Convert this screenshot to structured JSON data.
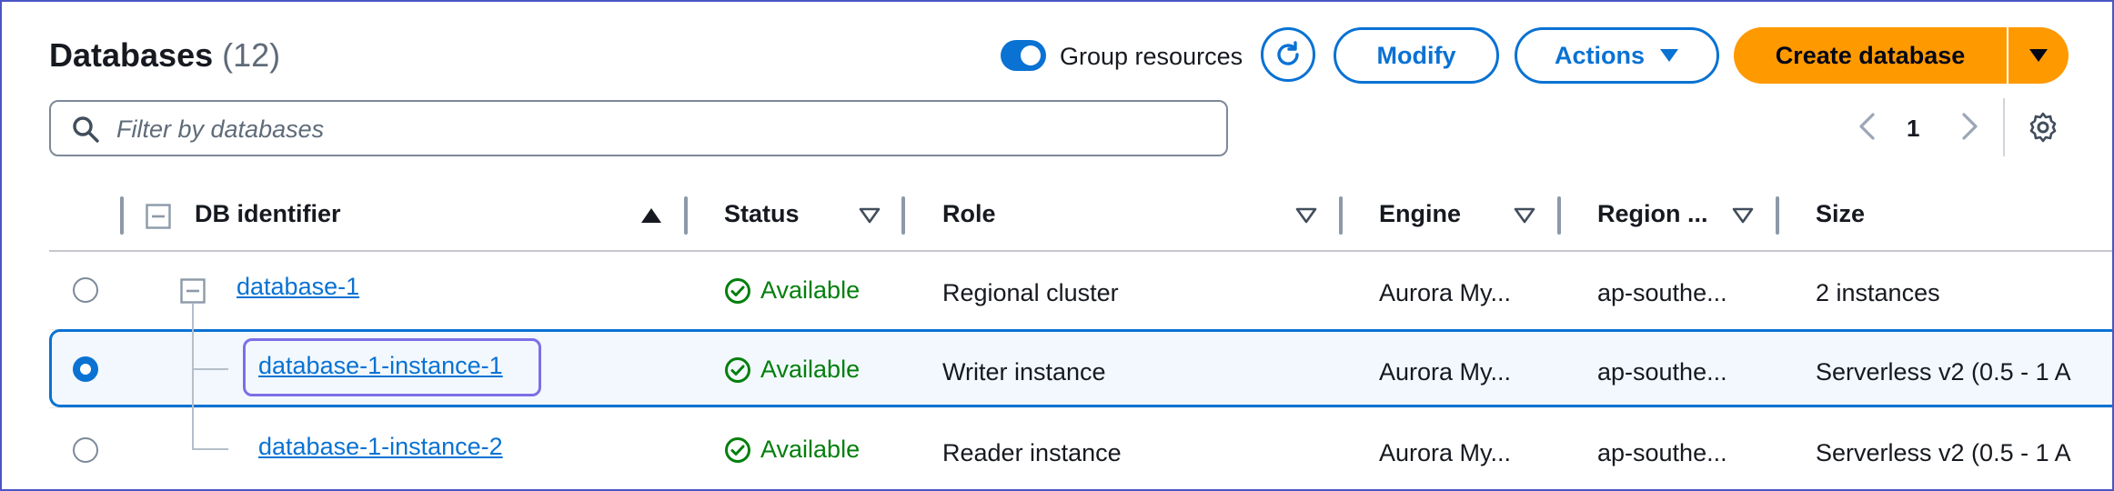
{
  "header": {
    "title": "Databases",
    "count": "(12)",
    "group_resources_label": "Group resources",
    "group_resources_on": true,
    "modify_label": "Modify",
    "actions_label": "Actions",
    "create_label": "Create database"
  },
  "filter": {
    "placeholder": "Filter by databases"
  },
  "pagination": {
    "current_page": "1"
  },
  "table": {
    "columns": [
      "DB identifier",
      "Status",
      "Role",
      "Engine",
      "Region ...",
      "Size"
    ],
    "rows": [
      {
        "identifier": "database-1",
        "status": "Available",
        "role": "Regional cluster",
        "engine": "Aurora My...",
        "region": "ap-southe...",
        "size": "2 instances",
        "selected": false
      },
      {
        "identifier": "database-1-instance-1",
        "status": "Available",
        "role": "Writer instance",
        "engine": "Aurora My...",
        "region": "ap-southe...",
        "size": "Serverless v2 (0.5 - 1 A",
        "selected": true
      },
      {
        "identifier": "database-1-instance-2",
        "status": "Available",
        "role": "Reader instance",
        "engine": "Aurora My...",
        "region": "ap-southe...",
        "size": "Serverless v2 (0.5 - 1 A",
        "selected": false
      }
    ]
  },
  "colors": {
    "accent": "#0972d3",
    "primary_button": "#ff9900",
    "status_success": "#037f0c",
    "focus": "#7c6fe6"
  }
}
